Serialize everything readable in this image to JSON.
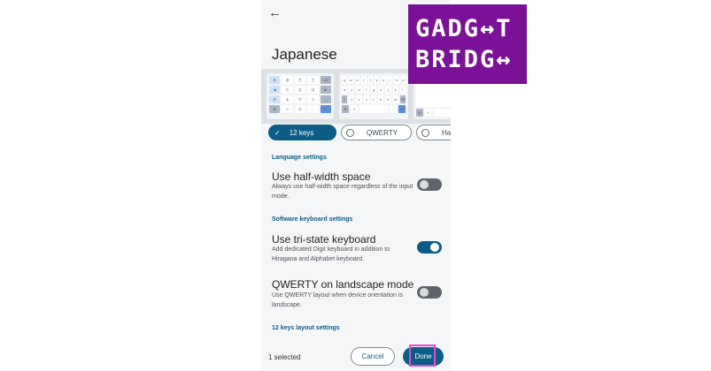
{
  "screen": {
    "title": "Japanese",
    "back_icon": "arrow-back-icon"
  },
  "layouts": {
    "items": [
      {
        "label": "12 keys",
        "selected": true
      },
      {
        "label": "QWERTY",
        "selected": false
      },
      {
        "label": "Handw",
        "selected": false
      }
    ]
  },
  "sections": {
    "language": "Language settings",
    "software_keyboard": "Software keyboard settings",
    "twelve_keys": "12 keys layout settings"
  },
  "settings": {
    "half_width": {
      "title": "Use half-width space",
      "description": "Always use half-width space regardless of the input mode.",
      "enabled": false
    },
    "tri_state": {
      "title": "Use tri-state keyboard",
      "description": "Add dedicated Digit keyboard in addition to Hiragana and Alphabet keyboard.",
      "enabled": true
    },
    "qwerty_landscape": {
      "title": "QWERTY on landscape mode",
      "description": "Use QWERTY layout when device orientation is landscape.",
      "enabled": false
    }
  },
  "bottom_bar": {
    "selected_count": "1 selected",
    "cancel_label": "Cancel",
    "done_label": "Done"
  },
  "logo": {
    "line1": "GADG↔T",
    "line2": "BRIDG↔"
  },
  "colors": {
    "accent": "#0b5d86",
    "logo_bg": "#7a1196",
    "highlight": "#e24bd0"
  }
}
